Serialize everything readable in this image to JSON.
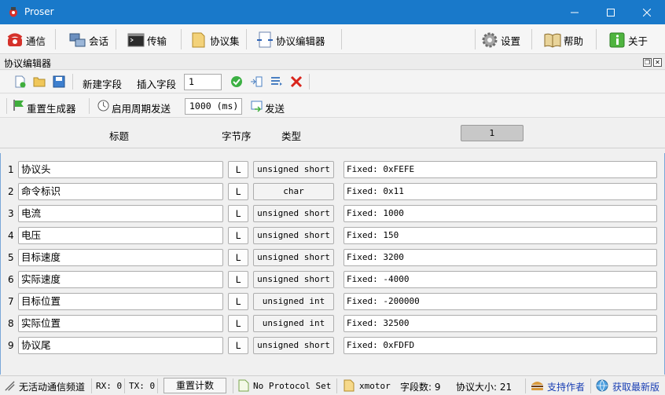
{
  "window": {
    "title": "Proser"
  },
  "main_toolbar": {
    "comm": "通信",
    "session": "会话",
    "transfer": "传输",
    "protocol_set": "协议集",
    "protocol_editor": "协议编辑器",
    "settings": "设置",
    "help": "帮助",
    "about": "关于"
  },
  "panel": {
    "title": "协议编辑器"
  },
  "editor_toolbar": {
    "new_field": "新建字段",
    "insert_field": "插入字段",
    "insert_index": "1"
  },
  "generator_toolbar": {
    "reset_generator": "重置生成器",
    "enable_periodic": "启用周期发送",
    "period_value": "1000 (ms)",
    "send": "发送"
  },
  "table": {
    "headers": {
      "title": "标题",
      "byte_order": "字节序",
      "type": "类型"
    },
    "column_index": "1",
    "rows": [
      {
        "num": "1",
        "name": "协议头",
        "endian": "L",
        "type": "unsigned short",
        "value": "Fixed: 0xFEFE"
      },
      {
        "num": "2",
        "name": "命令标识",
        "endian": "L",
        "type": "char",
        "value": "Fixed: 0x11"
      },
      {
        "num": "3",
        "name": "电流",
        "endian": "L",
        "type": "unsigned short",
        "value": "Fixed: 1000"
      },
      {
        "num": "4",
        "name": "电压",
        "endian": "L",
        "type": "unsigned short",
        "value": "Fixed: 150"
      },
      {
        "num": "5",
        "name": "目标速度",
        "endian": "L",
        "type": "unsigned short",
        "value": "Fixed: 3200"
      },
      {
        "num": "6",
        "name": "实际速度",
        "endian": "L",
        "type": "unsigned short",
        "value": "Fixed: -4000"
      },
      {
        "num": "7",
        "name": "目标位置",
        "endian": "L",
        "type": "unsigned int",
        "value": "Fixed: -200000"
      },
      {
        "num": "8",
        "name": "实际位置",
        "endian": "L",
        "type": "unsigned int",
        "value": "Fixed: 32500"
      },
      {
        "num": "9",
        "name": "协议尾",
        "endian": "L",
        "type": "unsigned short",
        "value": "Fixed: 0xFDFD"
      }
    ]
  },
  "status_bar": {
    "channel": "无活动通信频道",
    "rx": "RX: 0",
    "tx": "TX: 0",
    "reset_count": "重置计数",
    "protocol": "No Protocol Set",
    "device": "xmotor",
    "field_count": "字段数: 9",
    "protocol_size": "协议大小: 21",
    "support_author": "支持作者",
    "get_latest": "获取最新版"
  },
  "colors": {
    "titlebar": "#1979ca",
    "accept": "#3cb043",
    "delete": "#d9251c"
  },
  "icons": [
    "app-icon",
    "phone-icon",
    "session-icon",
    "terminal-icon",
    "folder-icon",
    "editor-icon",
    "gear-icon",
    "book-icon",
    "info-icon",
    "new-file-icon",
    "open-folder-icon",
    "save-icon",
    "check-icon",
    "split-icon",
    "list-icon",
    "delete-icon",
    "flag-icon",
    "clock-icon",
    "send-icon",
    "file-icon",
    "burger-icon",
    "globe-icon"
  ]
}
